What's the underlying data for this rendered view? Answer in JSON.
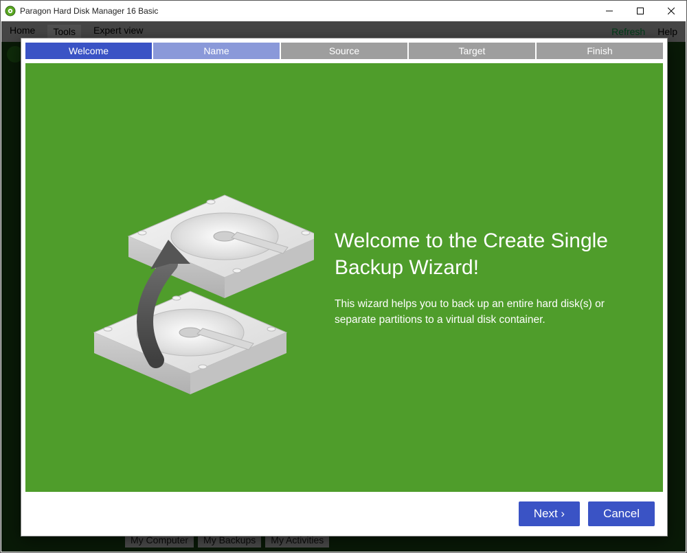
{
  "window": {
    "title": "Paragon Hard Disk Manager 16 Basic"
  },
  "background_app": {
    "menu_home": "Home",
    "menu_tools": "Tools",
    "menu_expert": "Expert view",
    "menu_refresh": "Refresh",
    "menu_help": "Help",
    "tab_computer": "My Computer",
    "tab_backups": "My Backups",
    "tab_activities": "My Activities"
  },
  "wizard": {
    "steps": {
      "welcome": "Welcome",
      "name": "Name",
      "source": "Source",
      "target": "Target",
      "finish": "Finish"
    },
    "heading": "Welcome to the Create Single Backup Wizard!",
    "subtext": "This wizard helps you to back up an entire hard disk(s) or separate partitions to a virtual disk container.",
    "next_label": "Next ›",
    "cancel_label": "Cancel"
  }
}
